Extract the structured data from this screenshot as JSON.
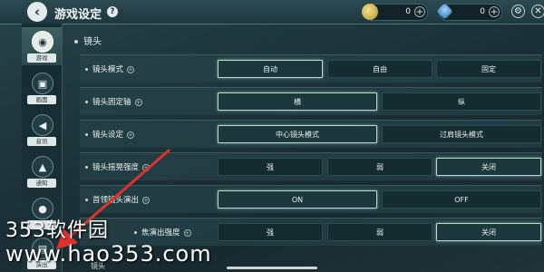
{
  "header": {
    "back_icon": "chevron-left-icon",
    "title": "游戏设定",
    "help_icon": "question-icon",
    "currencies": [
      {
        "icon": "gold-coin-icon",
        "value": "0"
      },
      {
        "icon": "gem-icon",
        "value": "0"
      }
    ],
    "plus_glyph": "+"
  },
  "sidebar": {
    "items": [
      {
        "label": "游戏",
        "icon": "gamepad-icon",
        "active": true
      },
      {
        "label": "画面",
        "icon": "image-icon",
        "active": false
      },
      {
        "label": "音讯",
        "icon": "speaker-icon",
        "active": false
      },
      {
        "label": "通知",
        "icon": "bell-icon",
        "active": false
      },
      {
        "label": "",
        "icon": "user-icon",
        "active": false
      },
      {
        "label": "演出",
        "icon": "film-icon",
        "active": false
      }
    ]
  },
  "section": {
    "title": "镜头"
  },
  "settings": [
    {
      "label": "镜头模式",
      "options": [
        "自动",
        "自由",
        "固定"
      ],
      "selected": 0
    },
    {
      "label": "镜头固定轴",
      "options": [
        "横",
        "纵"
      ],
      "selected": 0
    },
    {
      "label": "镜头设定",
      "options": [
        "中心镜头模式",
        "过肩镜头模式"
      ],
      "selected": 0
    },
    {
      "label": "镜头摇晃强度",
      "options": [
        "强",
        "弱",
        "关闭"
      ],
      "selected": 2
    },
    {
      "label": "首领镜头演出",
      "options": [
        "ON",
        "OFF"
      ],
      "selected": 0
    },
    {
      "label": "焦演出强度",
      "options": [
        "强",
        "弱",
        "关闭"
      ],
      "selected": 2
    }
  ],
  "footer": {
    "text": "镜头"
  },
  "watermark": {
    "line1": "353软件园",
    "line2": "www.hao353.com"
  },
  "colors": {
    "accent": "#b7dcd0",
    "arrow": "#e0322a"
  }
}
